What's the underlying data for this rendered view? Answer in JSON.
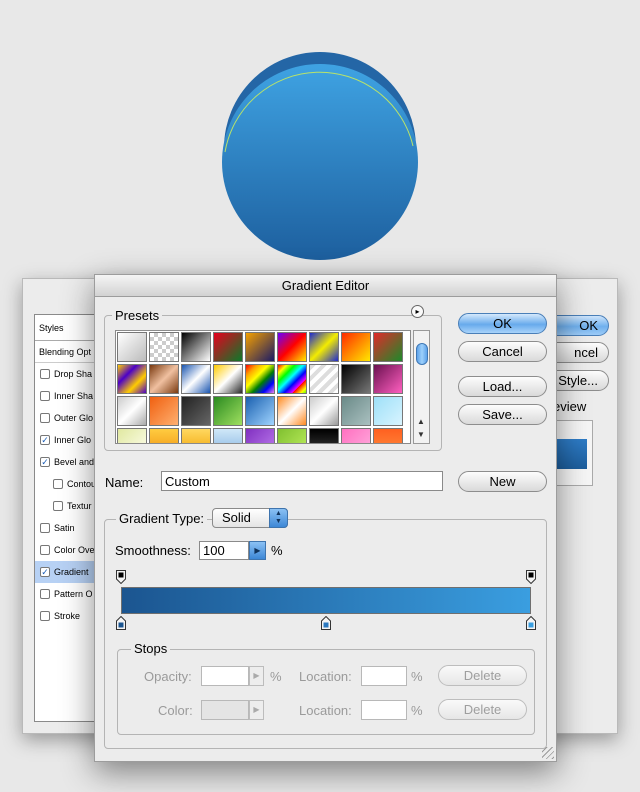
{
  "layer_style": {
    "styles_title": "Styles",
    "blending_options": "Blending Opt",
    "items": [
      {
        "label": "Drop Sha",
        "checked": false,
        "indent": false,
        "selected": false
      },
      {
        "label": "Inner Sha",
        "checked": false,
        "indent": false,
        "selected": false
      },
      {
        "label": "Outer Glo",
        "checked": false,
        "indent": false,
        "selected": false
      },
      {
        "label": "Inner Glo",
        "checked": true,
        "indent": false,
        "selected": false
      },
      {
        "label": "Bevel and",
        "checked": true,
        "indent": false,
        "selected": false
      },
      {
        "label": "Contou",
        "checked": false,
        "indent": true,
        "selected": false
      },
      {
        "label": "Textur",
        "checked": false,
        "indent": true,
        "selected": false
      },
      {
        "label": "Satin",
        "checked": false,
        "indent": false,
        "selected": false
      },
      {
        "label": "Color Ove",
        "checked": false,
        "indent": false,
        "selected": false
      },
      {
        "label": "Gradient",
        "checked": true,
        "indent": false,
        "selected": true
      },
      {
        "label": "Pattern O",
        "checked": false,
        "indent": false,
        "selected": false
      },
      {
        "label": "Stroke",
        "checked": false,
        "indent": false,
        "selected": false
      }
    ],
    "ok_label": "OK",
    "cancel_label": "ncel",
    "new_style_label": "Style...",
    "preview_label": "eview"
  },
  "gradient_editor": {
    "title": "Gradient Editor",
    "presets_label": "Presets",
    "presets_menu_icon": "flyout-arrow-icon",
    "buttons": {
      "ok": "OK",
      "cancel": "Cancel",
      "load": "Load...",
      "save": "Save...",
      "new": "New"
    },
    "name_label": "Name:",
    "name_value": "Custom",
    "gradient_type_label": "Gradient Type:",
    "gradient_type_value": "Solid",
    "smoothness_label": "Smoothness:",
    "smoothness_value": "100",
    "smoothness_unit": "%",
    "gradient": {
      "start_color": "#1b5590",
      "end_color": "#3a9ee0",
      "color_stops": [
        0,
        0.5,
        1
      ],
      "opacity_stops": [
        0,
        1
      ]
    },
    "stops": {
      "label": "Stops",
      "opacity_label": "Opacity:",
      "color_label": "Color:",
      "location_label": "Location:",
      "percent": "%",
      "delete_label": "Delete"
    }
  },
  "preset_swatches": [
    "linear-gradient(135deg,#fff,#bbb)",
    "repeating-conic-gradient(#ccc 0 25%,#fff 0 50%) 0 0/8px 8px",
    "linear-gradient(135deg,#000,#fff)",
    "linear-gradient(135deg,#e6001e,#0a7a2a)",
    "linear-gradient(135deg,#f4a000,#1a1a66)",
    "linear-gradient(135deg,#6a00ff,#ff0000,#ffee00)",
    "linear-gradient(135deg,#1e2ad0,#f3ec00,#1e2ad0)",
    "linear-gradient(135deg,#ff2a00,#ffe800)",
    "linear-gradient(135deg,#e02a2a,#1d8a2a)",
    "linear-gradient(135deg,#ffcc00,#4b00c8,#ffcc00,#4b00c8)",
    "linear-gradient(135deg,#7a3a10,#f0c0a0,#7a3a10)",
    "linear-gradient(135deg,#1a55b0,#fff,#1a55b0)",
    "linear-gradient(135deg,#ffcc00,#fff,#2a2a2a)",
    "linear-gradient(135deg,red,orange,yellow,green,blue,violet)",
    "repeating-linear-gradient(135deg,red,yellow 6px,lime 12px,cyan 18px,blue 24px,magenta 30px)",
    "repeating-linear-gradient(135deg,#ddd 0 4px,#fff 4px 8px)",
    "linear-gradient(135deg,#000,#777)",
    "linear-gradient(135deg,#6a1050,#ff60c0)",
    "linear-gradient(135deg,#ccc,#fff,#aaa)",
    "linear-gradient(135deg,#f06010,#ffb070)",
    "linear-gradient(135deg,#222,#666)",
    "linear-gradient(135deg,#2a8a20,#a0e060)",
    "linear-gradient(135deg,#1a60b0,#a0d4ff)",
    "linear-gradient(135deg,#ff8a20,#fff,#ff8a20)",
    "linear-gradient(135deg,#ccc,#fff,#999)",
    "linear-gradient(135deg,#6a8a88,#aac0c0)",
    "linear-gradient(135deg,#9ee0f8,#d8f4ff)",
    "linear-gradient(135deg,#e0e8a0,#fffff0)",
    "linear-gradient(#ffcc40,#f09010)",
    "linear-gradient(#ffd860,#f0a000)",
    "linear-gradient(#d0e8f8,#80b0e0)",
    "linear-gradient(135deg,#8030c0,#c080f0)",
    "linear-gradient(135deg,#80c030,#c0f060)",
    "linear-gradient(#000,#444)",
    "linear-gradient(135deg,#ff70c0,#ffb0e0)",
    "linear-gradient(#ff6020,#ff9040)",
    "linear-gradient(#e0f0ff,#a8d0f0)"
  ]
}
